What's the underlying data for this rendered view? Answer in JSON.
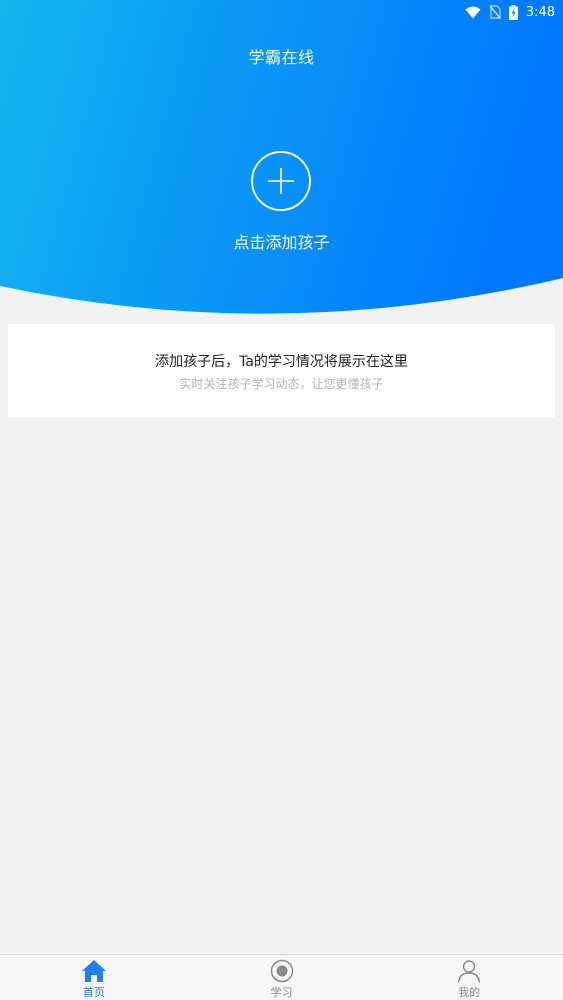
{
  "status_bar": {
    "time": "3:48",
    "icons": [
      "wifi-icon",
      "no-sim-icon",
      "battery-charging-icon"
    ]
  },
  "header": {
    "title": "学霸在线",
    "gradient": {
      "from": "#14b4ee",
      "to": "#0077ff"
    }
  },
  "add_child": {
    "icon": "plus-icon",
    "label": "点击添加孩子"
  },
  "info_card": {
    "title": "添加孩子后，Ta的学习情况将展示在这里",
    "subtitle": "实时关注孩子学习动态，让您更懂孩子"
  },
  "tabbar": {
    "active_color": "#1f7ff5",
    "inactive_color": "#8a8a8a",
    "items": [
      {
        "label": "首页",
        "icon": "home-icon",
        "active": true
      },
      {
        "label": "学习",
        "icon": "record-icon",
        "active": false
      },
      {
        "label": "我的",
        "icon": "person-icon",
        "active": false
      }
    ]
  }
}
